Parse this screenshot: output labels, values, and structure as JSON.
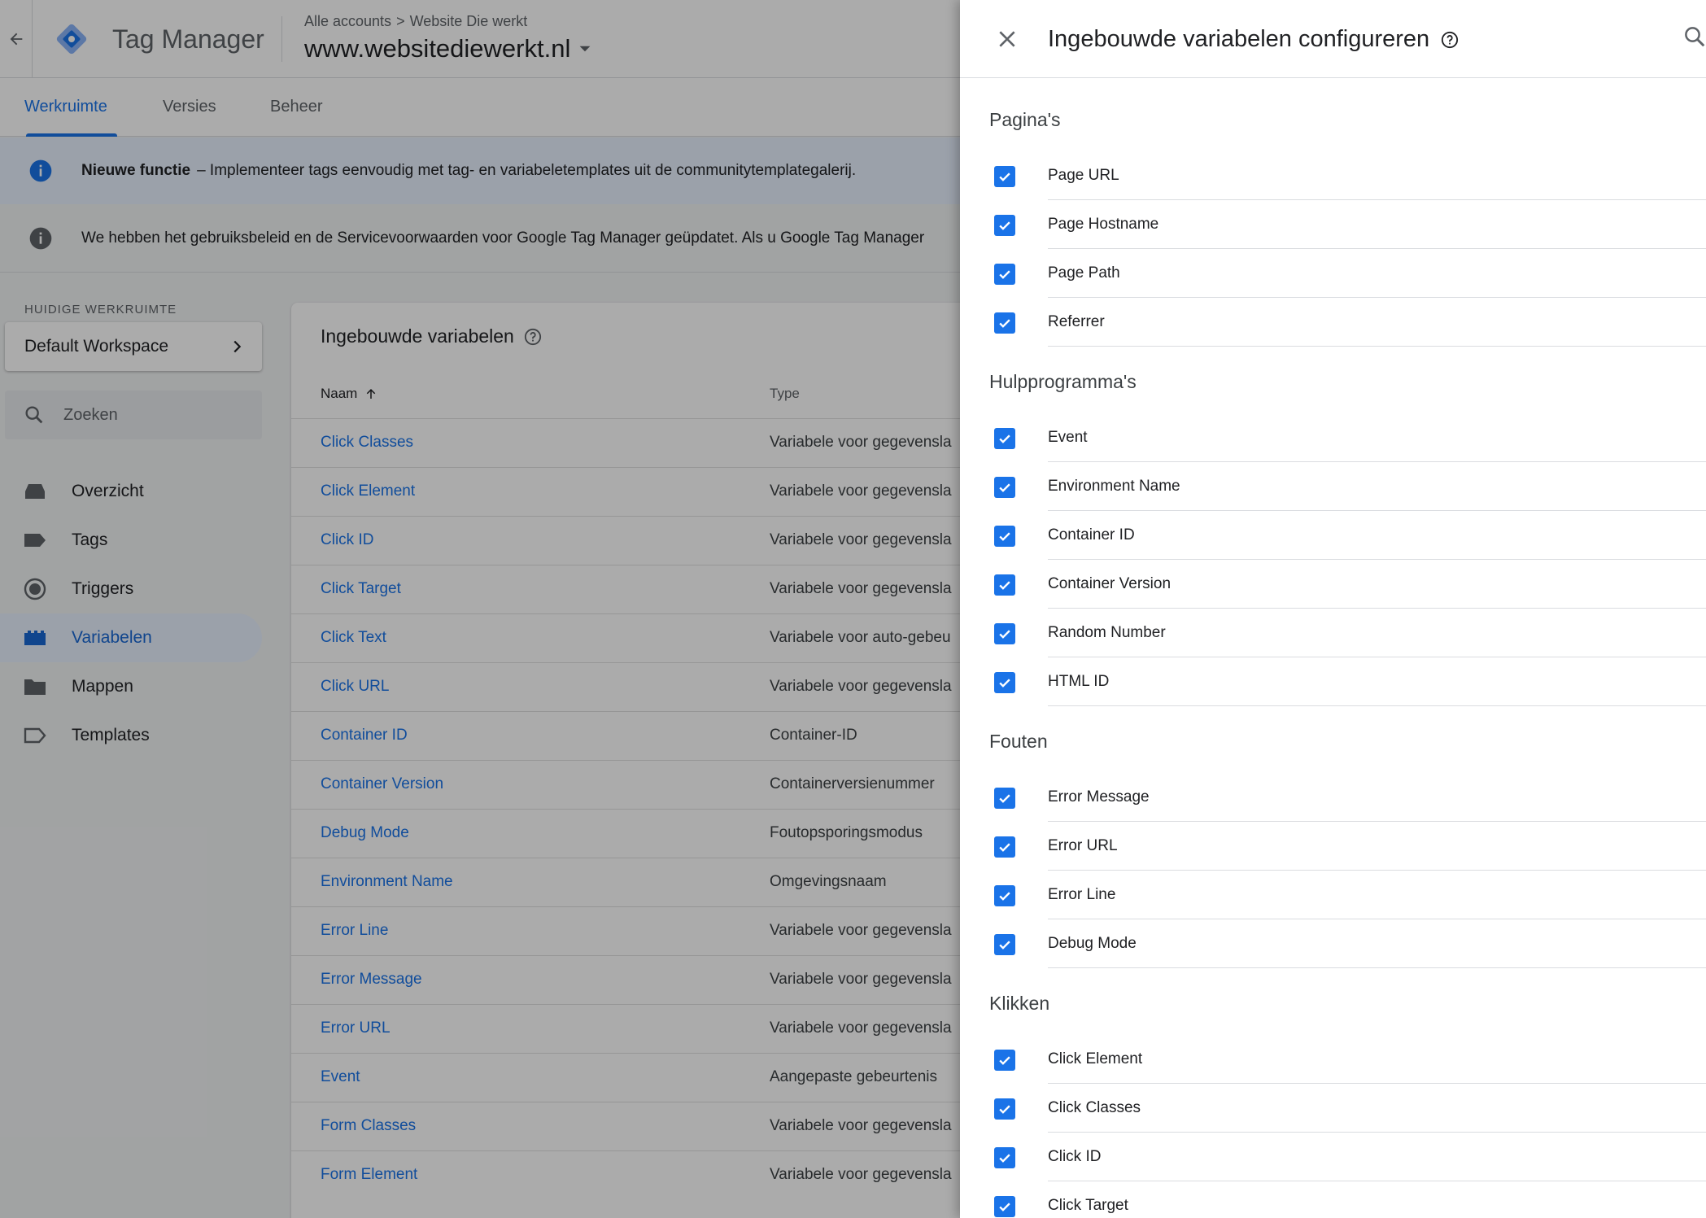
{
  "colors": {
    "accent": "#1a73e8",
    "info_banner": "#e8f0fe",
    "scrim": "rgba(0,0,0,0.33)"
  },
  "header": {
    "product_name": "Tag Manager",
    "breadcrumb": {
      "account": "Alle accounts",
      "separator": ">",
      "subaccount": "Website Die werkt"
    },
    "container_name": "www.websitediewerkt.nl"
  },
  "nav": {
    "tabs": [
      {
        "label": "Werkruimte",
        "active": true
      },
      {
        "label": "Versies",
        "active": false
      },
      {
        "label": "Beheer",
        "active": false
      }
    ]
  },
  "banners": {
    "feature": {
      "title": "Nieuwe functie",
      "text": "– Implementeer tags eenvoudig met tag- en variabeletemplates uit de communitytemplategalerij."
    },
    "policy": {
      "text": "We hebben het gebruiksbeleid en de Servicevoorwaarden voor Google Tag Manager geüpdatet. Als u Google Tag Manager"
    }
  },
  "sidebar": {
    "workspace_label": "HUIDIGE WERKRUIMTE",
    "workspace_name": "Default Workspace",
    "search_placeholder": "Zoeken",
    "items": [
      {
        "label": "Overzicht",
        "icon": "overview-icon",
        "active": false
      },
      {
        "label": "Tags",
        "icon": "tag-icon",
        "active": false
      },
      {
        "label": "Triggers",
        "icon": "trigger-icon",
        "active": false
      },
      {
        "label": "Variabelen",
        "icon": "variables-icon",
        "active": true
      },
      {
        "label": "Mappen",
        "icon": "folder-icon",
        "active": false
      },
      {
        "label": "Templates",
        "icon": "template-icon",
        "active": false
      }
    ]
  },
  "variables_table": {
    "title": "Ingebouwde variabelen",
    "columns": {
      "name": "Naam",
      "type": "Type"
    },
    "rows": [
      {
        "name": "Click Classes",
        "type": "Variabele voor gegevensla"
      },
      {
        "name": "Click Element",
        "type": "Variabele voor gegevensla"
      },
      {
        "name": "Click ID",
        "type": "Variabele voor gegevensla"
      },
      {
        "name": "Click Target",
        "type": "Variabele voor gegevensla"
      },
      {
        "name": "Click Text",
        "type": "Variabele voor auto-gebeu"
      },
      {
        "name": "Click URL",
        "type": "Variabele voor gegevensla"
      },
      {
        "name": "Container ID",
        "type": "Container-ID"
      },
      {
        "name": "Container Version",
        "type": "Containerversienummer"
      },
      {
        "name": "Debug Mode",
        "type": "Foutopsporingsmodus"
      },
      {
        "name": "Environment Name",
        "type": "Omgevingsnaam"
      },
      {
        "name": "Error Line",
        "type": "Variabele voor gegevensla"
      },
      {
        "name": "Error Message",
        "type": "Variabele voor gegevensla"
      },
      {
        "name": "Error URL",
        "type": "Variabele voor gegevensla"
      },
      {
        "name": "Event",
        "type": "Aangepaste gebeurtenis"
      },
      {
        "name": "Form Classes",
        "type": "Variabele voor gegevensla"
      },
      {
        "name": "Form Element",
        "type": "Variabele voor gegevensla"
      }
    ]
  },
  "panel": {
    "title": "Ingebouwde variabelen configureren",
    "sections": [
      {
        "title": "Pagina's",
        "items": [
          {
            "label": "Page URL",
            "checked": true
          },
          {
            "label": "Page Hostname",
            "checked": true
          },
          {
            "label": "Page Path",
            "checked": true
          },
          {
            "label": "Referrer",
            "checked": true
          }
        ]
      },
      {
        "title": "Hulpprogramma's",
        "items": [
          {
            "label": "Event",
            "checked": true
          },
          {
            "label": "Environment Name",
            "checked": true
          },
          {
            "label": "Container ID",
            "checked": true
          },
          {
            "label": "Container Version",
            "checked": true
          },
          {
            "label": "Random Number",
            "checked": true
          },
          {
            "label": "HTML ID",
            "checked": true
          }
        ]
      },
      {
        "title": "Fouten",
        "items": [
          {
            "label": "Error Message",
            "checked": true
          },
          {
            "label": "Error URL",
            "checked": true
          },
          {
            "label": "Error Line",
            "checked": true
          },
          {
            "label": "Debug Mode",
            "checked": true
          }
        ]
      },
      {
        "title": "Klikken",
        "items": [
          {
            "label": "Click Element",
            "checked": true
          },
          {
            "label": "Click Classes",
            "checked": true
          },
          {
            "label": "Click ID",
            "checked": true
          },
          {
            "label": "Click Target",
            "checked": true
          }
        ]
      }
    ]
  }
}
